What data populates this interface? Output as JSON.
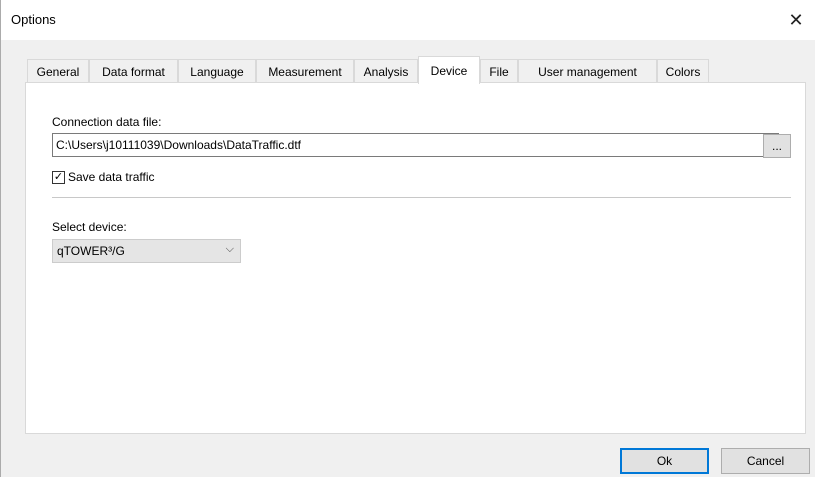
{
  "window": {
    "title": "Options",
    "close_glyph": "✕"
  },
  "tabs": [
    {
      "label": "General"
    },
    {
      "label": "Data format"
    },
    {
      "label": "Language"
    },
    {
      "label": "Measurement"
    },
    {
      "label": "Analysis"
    },
    {
      "label": "Device"
    },
    {
      "label": "File"
    },
    {
      "label": "User management"
    },
    {
      "label": "Colors"
    }
  ],
  "active_tab": "Device",
  "device_tab": {
    "connection_label": "Connection data file:",
    "connection_value": "C:\\Users\\j10111039\\Downloads\\DataTraffic.dtf",
    "browse_label": "...",
    "save_traffic_label": "Save data traffic",
    "save_traffic_checked": true,
    "check_glyph": "✓",
    "select_device_label": "Select device:",
    "select_device_value": "qTOWER³/G",
    "chevron_glyph": "⌵"
  },
  "buttons": {
    "ok": "Ok",
    "cancel": "Cancel"
  },
  "colors": {
    "default_button_border": "#0078d7"
  }
}
